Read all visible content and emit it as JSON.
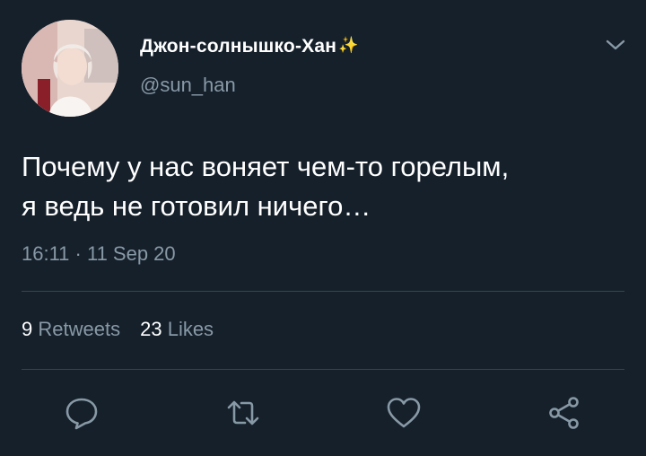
{
  "user": {
    "display_name": "Джон-солнышко-Хан",
    "name_emoji": "✨",
    "handle": "@sun_han"
  },
  "tweet": {
    "text_line1": "Почему у нас воняет чем-то горелым,",
    "text_line2": "я ведь не готовил ничего…",
    "timestamp": "16:11 · 11 Sep 20"
  },
  "stats": {
    "retweets_count": "9",
    "retweets_label": "Retweets",
    "likes_count": "23",
    "likes_label": "Likes"
  },
  "actions": {
    "reply_icon": "reply-icon",
    "retweet_icon": "retweet-icon",
    "like_icon": "heart-icon",
    "share_icon": "share-icon"
  },
  "colors": {
    "background": "#15202b",
    "text_primary": "#ffffff",
    "text_secondary": "#8899a6",
    "divider": "#38444d"
  }
}
